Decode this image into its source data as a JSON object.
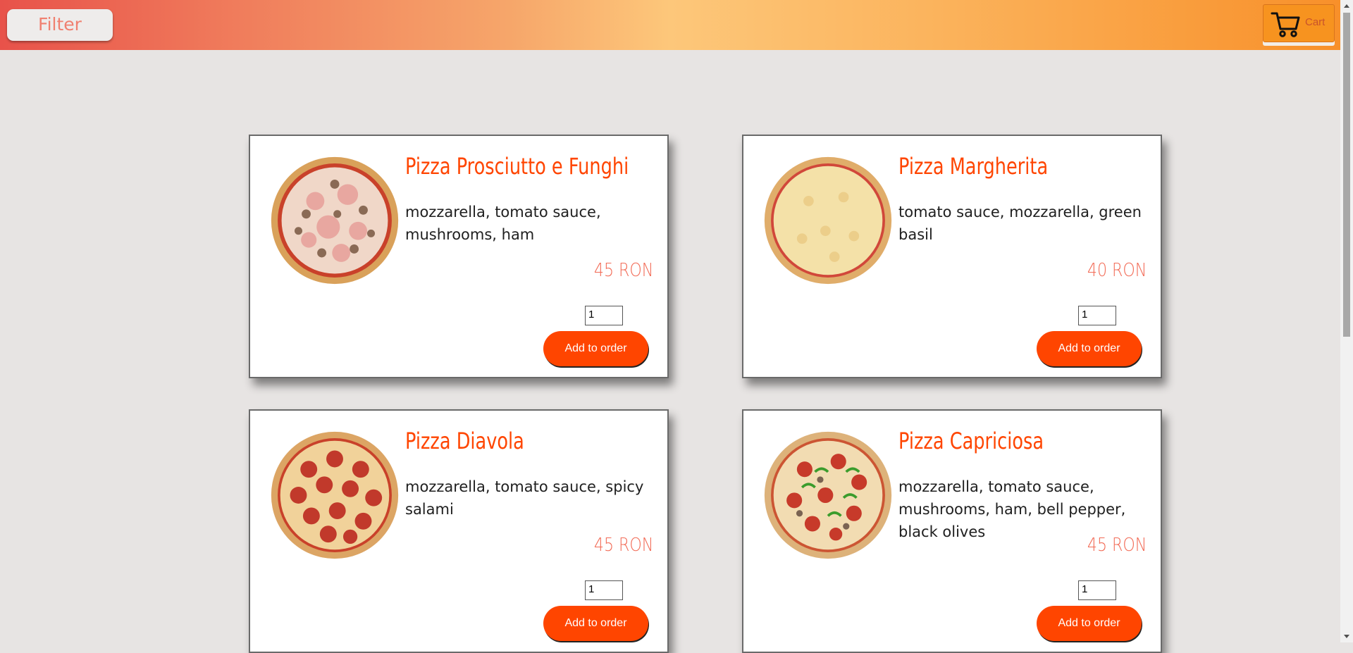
{
  "header": {
    "filter_label": "Filter",
    "cart_label": "Cart"
  },
  "products": [
    {
      "name": "Pizza Prosciutto e Funghi",
      "description": "mozzarella, tomato sauce, mushrooms, ham",
      "price": "45 RON",
      "quantity": "1",
      "button_label": "Add to order"
    },
    {
      "name": "Pizza Margherita",
      "description": "tomato sauce, mozzarella, green basil",
      "price": "40 RON",
      "quantity": "1",
      "button_label": "Add to order"
    },
    {
      "name": "Pizza Diavola",
      "description": "mozzarella, tomato sauce, spicy salami",
      "price": "45 RON",
      "quantity": "1",
      "button_label": "Add to order"
    },
    {
      "name": "Pizza Capriciosa",
      "description": "mozzarella, tomato sauce, mushrooms, ham, bell pepper, black olives",
      "price": "45 RON",
      "quantity": "1",
      "button_label": "Add to order"
    }
  ],
  "colors": {
    "accent": "#ff4500",
    "price": "#f26a55",
    "background": "#e7e4e3"
  },
  "icons": [
    "cart-icon",
    "pizza-image"
  ]
}
